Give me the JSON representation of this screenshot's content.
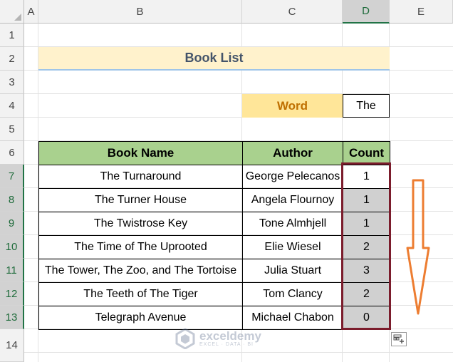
{
  "columns": [
    "A",
    "B",
    "C",
    "D",
    "E"
  ],
  "selected_column": "D",
  "rows": [
    "1",
    "2",
    "3",
    "4",
    "5",
    "6",
    "7",
    "8",
    "9",
    "10",
    "11",
    "12",
    "13",
    "14"
  ],
  "selected_rows": [
    "7",
    "8",
    "9",
    "10",
    "11",
    "12",
    "13"
  ],
  "title": "Book List",
  "word": {
    "label": "Word",
    "value": "The"
  },
  "table": {
    "headers": [
      "Book Name",
      "Author",
      "Count"
    ],
    "rows": [
      [
        "The Turnaround",
        "George Pelecanos",
        "1"
      ],
      [
        "The Turner House",
        "Angela Flournoy",
        "1"
      ],
      [
        "The Twistrose Key",
        "Tone Almhjell",
        "1"
      ],
      [
        "The Time of The Uprooted",
        "Elie Wiesel",
        "2"
      ],
      [
        "The Tower, The Zoo, and The Tortoise",
        "Julia Stuart",
        "3"
      ],
      [
        "The Teeth of The Tiger",
        "Tom Clancy",
        "2"
      ],
      [
        "Telegraph Avenue",
        "Michael Chabon",
        "0"
      ]
    ]
  },
  "watermark": {
    "name": "exceldemy",
    "tagline": "EXCEL · DATA · BI"
  },
  "colors": {
    "title_fill": "#fff2cc",
    "word_label_fill": "#ffe699",
    "header_fill": "#a9d18e",
    "count_fill": "#d0d0d0",
    "highlight_border": "#7b1c2c",
    "arrow": "#ed7d31"
  }
}
